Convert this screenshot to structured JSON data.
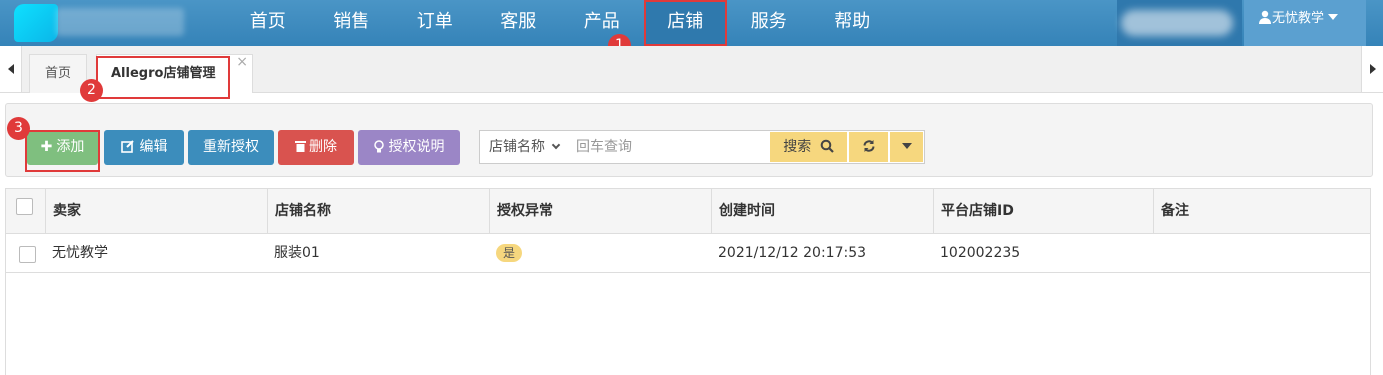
{
  "nav": {
    "items": [
      "首页",
      "销售",
      "订单",
      "客服",
      "产品",
      "店铺",
      "服务",
      "帮助"
    ],
    "active_index": 5
  },
  "user": {
    "name": "无忧教学"
  },
  "tabs": {
    "home": "首页",
    "active": "Allegro店铺管理",
    "close": "×"
  },
  "toolbar": {
    "add": "添加",
    "edit": "编辑",
    "reauth": "重新授权",
    "delete": "删除",
    "auth_help": "授权说明"
  },
  "search": {
    "field": "店铺名称",
    "placeholder": "回车查询",
    "button": "搜索"
  },
  "table": {
    "headers": [
      "卖家",
      "店铺名称",
      "授权异常",
      "创建时间",
      "平台店铺ID",
      "备注"
    ],
    "rows": [
      {
        "seller": "无忧教学",
        "shop_name": "服装01",
        "auth_error": "是",
        "created": "2021/12/12 20:17:53",
        "platform_id": "102002235",
        "remark": ""
      }
    ]
  },
  "steps": [
    "1",
    "2",
    "3"
  ],
  "colors": {
    "nav_bg": "#3c8dbc",
    "highlight": "#e03a3a",
    "add": "#7fbf7f",
    "primary": "#3c8dbc",
    "danger": "#d9534f",
    "purple": "#9b86c6",
    "warning": "#f6d77e"
  }
}
